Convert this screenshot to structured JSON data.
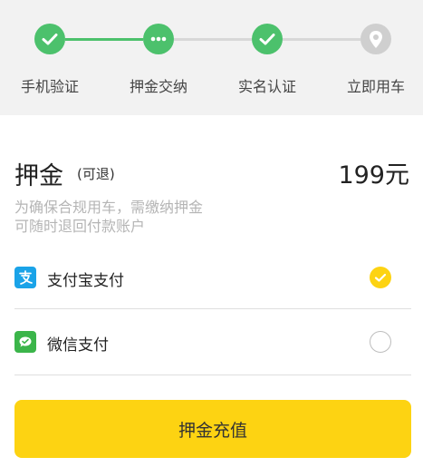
{
  "steps": [
    {
      "label": "手机验证",
      "status": "done",
      "icon": "check-icon"
    },
    {
      "label": "押金交纳",
      "status": "current",
      "icon": "dots-icon"
    },
    {
      "label": "实名认证",
      "status": "done",
      "icon": "check-icon"
    },
    {
      "label": "立即用车",
      "status": "pending",
      "icon": "location-pin-icon"
    }
  ],
  "deposit": {
    "title": "押金",
    "refundable": "(可退)",
    "amount": "199元",
    "desc_line1": "为确保合规用车，需缴纳押金",
    "desc_line2": "可随时退回付款账户"
  },
  "payment": [
    {
      "label": "支付宝支付",
      "icon": "alipay-icon",
      "selected": true
    },
    {
      "label": "微信支付",
      "icon": "wechat-pay-icon",
      "selected": false
    }
  ],
  "submit_label": "押金充值",
  "colors": {
    "accent_green": "#4cc16c",
    "selected_yellow": "#fdd312",
    "pending_gray": "#cfcfcf",
    "alipay_blue": "#1aa3e8",
    "wechat_green": "#3bb54a"
  }
}
